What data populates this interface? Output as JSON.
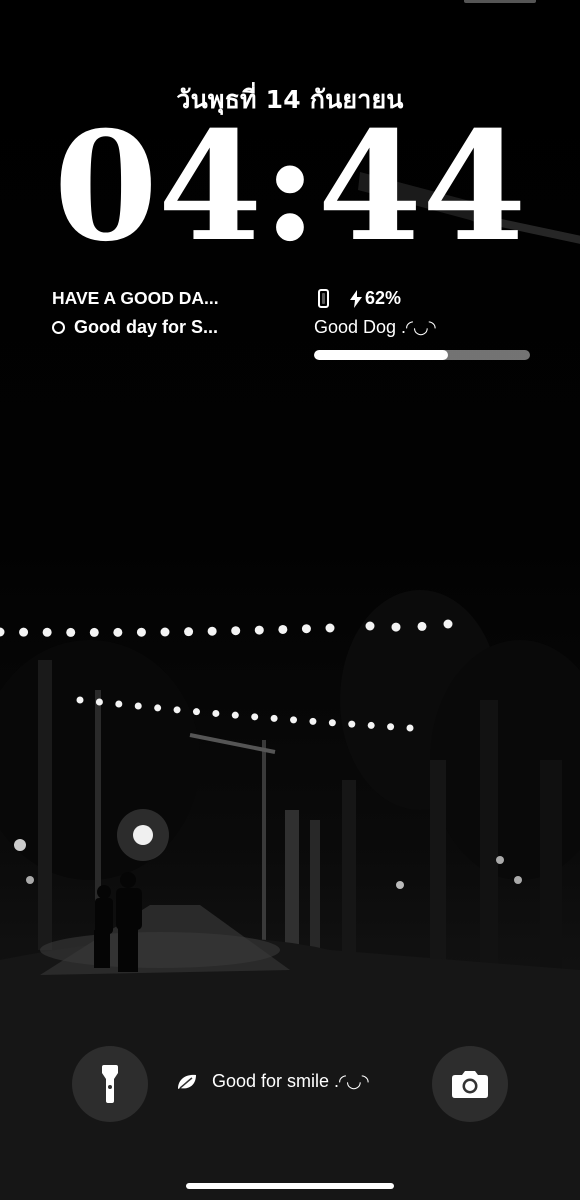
{
  "lockscreen": {
    "date": "วันพุธที่ 14 กันยายน",
    "time": "04:44"
  },
  "widgets": {
    "reminder": {
      "title": "HAVE A GOOD DA...",
      "item": "Good day for S..."
    },
    "battery": {
      "percent_text": "62%",
      "percent_value": 62,
      "label": "Good Dog .◜◡◝",
      "charging": true
    }
  },
  "bottom": {
    "focus_text": "Good for smile .◜◡◝",
    "flashlight_icon": "flashlight-icon",
    "camera_icon": "camera-icon"
  },
  "colors": {
    "text": "#ffffff",
    "button_bg": "#323232",
    "progress_track": "#737373"
  }
}
